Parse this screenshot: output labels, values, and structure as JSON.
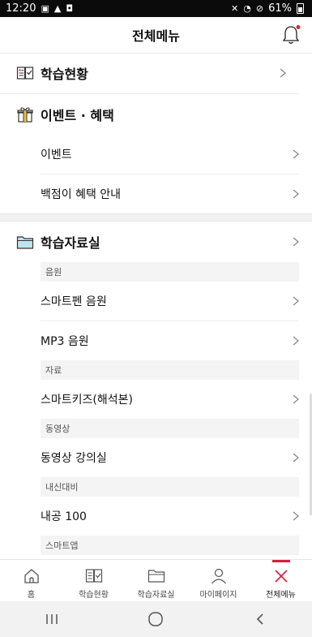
{
  "status_bar": {
    "time": "12:20",
    "battery": "61%"
  },
  "header": {
    "title": "전체메뉴"
  },
  "sections": {
    "study_status": {
      "label": "학습현황"
    },
    "events": {
      "label": "이벤트 · 혜택",
      "items": [
        "이벤트",
        "백점이 혜택 안내"
      ]
    },
    "library": {
      "label": "학습자료실",
      "groups": [
        {
          "heading": "음원",
          "items": [
            "스마트펜 음원",
            "MP3 음원"
          ]
        },
        {
          "heading": "자료",
          "items": [
            "스마트키즈(해석본)"
          ]
        },
        {
          "heading": "동영상",
          "items": [
            "동영상 강의실"
          ]
        },
        {
          "heading": "내신대비",
          "items": [
            "내공 100"
          ]
        },
        {
          "heading": "스마트앱",
          "items": []
        }
      ]
    }
  },
  "tabs": [
    {
      "label": "홈",
      "icon": "home-icon"
    },
    {
      "label": "학습현황",
      "icon": "book-icon"
    },
    {
      "label": "학습자료실",
      "icon": "folder-icon"
    },
    {
      "label": "마이페이지",
      "icon": "person-icon"
    },
    {
      "label": "전체메뉴",
      "icon": "close-icon"
    }
  ],
  "colors": {
    "accent": "#d81c3f",
    "notification_dot": "#e0262e"
  }
}
